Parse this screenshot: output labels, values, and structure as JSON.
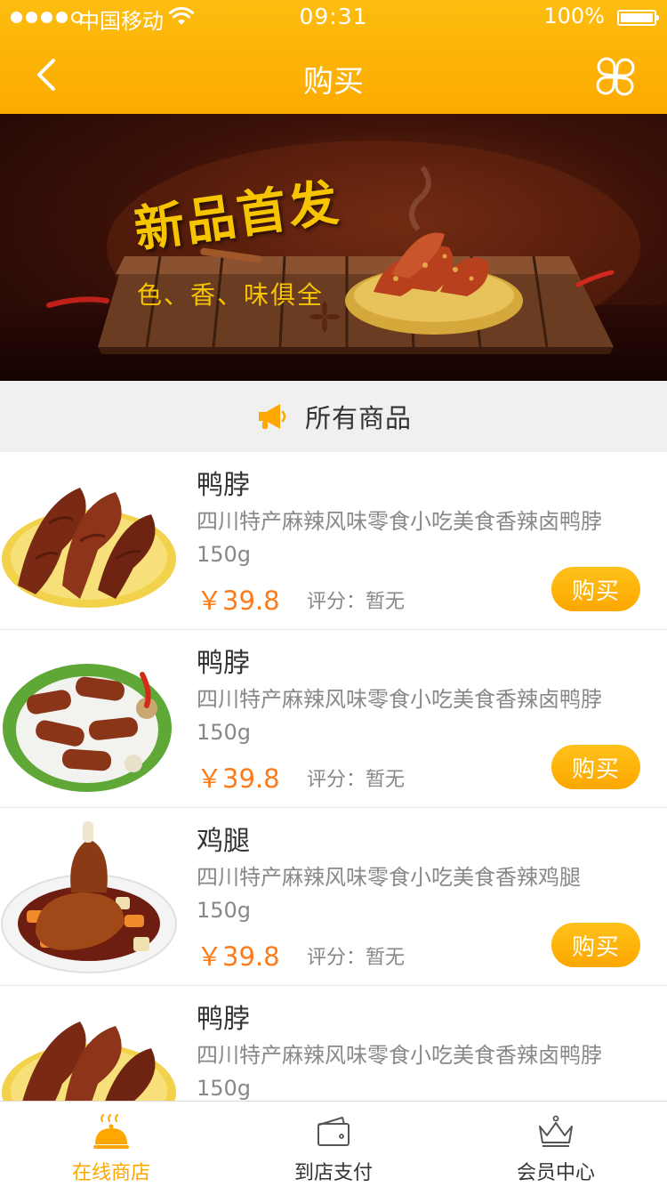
{
  "status_bar": {
    "carrier": "中国移动",
    "time": "09:31",
    "battery": "100%"
  },
  "nav": {
    "title": "购买",
    "back_icon": "chevron-left-icon",
    "menu_icon": "clover-grid-icon"
  },
  "banner": {
    "title": "新品首发",
    "subtitle": "色、香、味俱全"
  },
  "section": {
    "title": "所有商品",
    "icon": "megaphone-icon"
  },
  "products": [
    {
      "name": "鸭脖",
      "desc_line1": "四川特产麻辣风味零食小吃美食香辣卤鸭脖",
      "desc_line2": "150g",
      "price": "￥39.8",
      "rating": "评分：暂无",
      "buy_label": "购买"
    },
    {
      "name": "鸭脖",
      "desc_line1": "四川特产麻辣风味零食小吃美食香辣卤鸭脖",
      "desc_line2": "150g",
      "price": "￥39.8",
      "rating": "评分：暂无",
      "buy_label": "购买"
    },
    {
      "name": "鸡腿",
      "desc_line1": "四川特产麻辣风味零食小吃美食香辣鸡腿",
      "desc_line2": "150g",
      "price": "￥39.8",
      "rating": "评分：暂无",
      "buy_label": "购买"
    },
    {
      "name": "鸭脖",
      "desc_line1": "四川特产麻辣风味零食小吃美食香辣卤鸭脖",
      "desc_line2": "150g",
      "price": "",
      "rating": "",
      "buy_label": ""
    }
  ],
  "tabs": [
    {
      "label": "在线商店",
      "icon": "cloche-icon",
      "active": true
    },
    {
      "label": "到店支付",
      "icon": "wallet-icon",
      "active": false
    },
    {
      "label": "会员中心",
      "icon": "crown-icon",
      "active": false
    }
  ],
  "colors": {
    "accent": "#fda700",
    "price": "#ff7b1a",
    "section_bg": "#f0f0f0"
  }
}
